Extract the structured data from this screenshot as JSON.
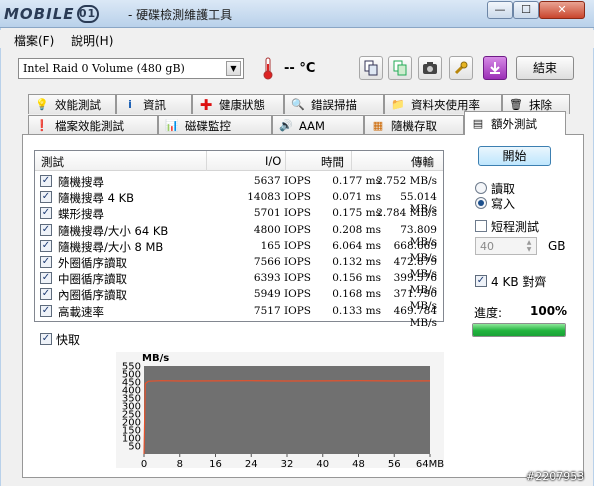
{
  "window": {
    "logo_text": "MOBILE",
    "logo_num": "01",
    "title": "- 硬碟檢測維護工具",
    "min_label": "—",
    "max_label": "☐",
    "close_label": "✕"
  },
  "menu": [
    "檔案(F)",
    "說明(H)"
  ],
  "toolbar": {
    "drive": "Intel   Raid 0 Volume (480 gB)",
    "temperature": "-- °C",
    "exit_label": "結束"
  },
  "tabs_row1": [
    "效能測試",
    "資訊",
    "健康狀態",
    "錯誤掃描",
    "資料夾使用率",
    "抹除"
  ],
  "tabs_row2": [
    "檔案效能測試",
    "磁碟監控",
    "AAM",
    "隨機存取",
    "額外測試"
  ],
  "table": {
    "headers": [
      "測試",
      "I/O",
      "時間",
      "傳輸"
    ],
    "rows": [
      {
        "name": "隨機搜尋",
        "io": "5637 IOPS",
        "time": "0.177 ms",
        "speed": "2.752 MB/s"
      },
      {
        "name": "隨機搜尋 4 KB",
        "io": "14083 IOPS",
        "time": "0.071 ms",
        "speed": "55.014 MB/s"
      },
      {
        "name": "蝶形搜尋",
        "io": "5701 IOPS",
        "time": "0.175 ms",
        "speed": "2.784 MB/s"
      },
      {
        "name": "隨機搜尋/大小 64 KB",
        "io": "4800 IOPS",
        "time": "0.208 ms",
        "speed": "73.809 MB/s"
      },
      {
        "name": "隨機搜尋/大小 8 MB",
        "io": "165 IOPS",
        "time": "6.064 ms",
        "speed": "668.669 MB/s"
      },
      {
        "name": "外圈循序讀取",
        "io": "7566 IOPS",
        "time": "0.132 ms",
        "speed": "472.879 MB/s"
      },
      {
        "name": "中圈循序讀取",
        "io": "6393 IOPS",
        "time": "0.156 ms",
        "speed": "399.576 MB/s"
      },
      {
        "name": "內圈循序讀取",
        "io": "5949 IOPS",
        "time": "0.168 ms",
        "speed": "371.790 MB/s"
      },
      {
        "name": "高載速率",
        "io": "7517 IOPS",
        "time": "0.133 ms",
        "speed": "469.784 MB/s"
      }
    ]
  },
  "quick_label": "快取",
  "controls": {
    "start_label": "開始",
    "read_label": "讀取",
    "write_label": "寫入",
    "short_test_label": "短程測試",
    "size_value": "40",
    "size_unit": "GB",
    "align_label": "4 KB 對齊",
    "progress_label": "進度:",
    "progress_value": "100%",
    "progress_fraction": 1.0
  },
  "chart_data": {
    "type": "line",
    "ylabel": "MB/s",
    "y_ticks": [
      550,
      500,
      450,
      400,
      350,
      300,
      250,
      200,
      150,
      100,
      50
    ],
    "x_ticks": [
      "0",
      "8",
      "16",
      "24",
      "32",
      "40",
      "48",
      "56",
      "64MB"
    ],
    "ylim": [
      0,
      550
    ],
    "xlim": [
      0,
      64
    ],
    "series": [
      {
        "values": [
          [
            0,
            0
          ],
          [
            0.3,
            440
          ],
          [
            1,
            455
          ],
          [
            4,
            458
          ],
          [
            8,
            456
          ],
          [
            16,
            457
          ],
          [
            24,
            458
          ],
          [
            32,
            456
          ],
          [
            40,
            457
          ],
          [
            48,
            458
          ],
          [
            56,
            456
          ],
          [
            64,
            457
          ]
        ]
      }
    ],
    "line_color": "#e8512a",
    "background": "#707070"
  },
  "watermark": "#2207953"
}
